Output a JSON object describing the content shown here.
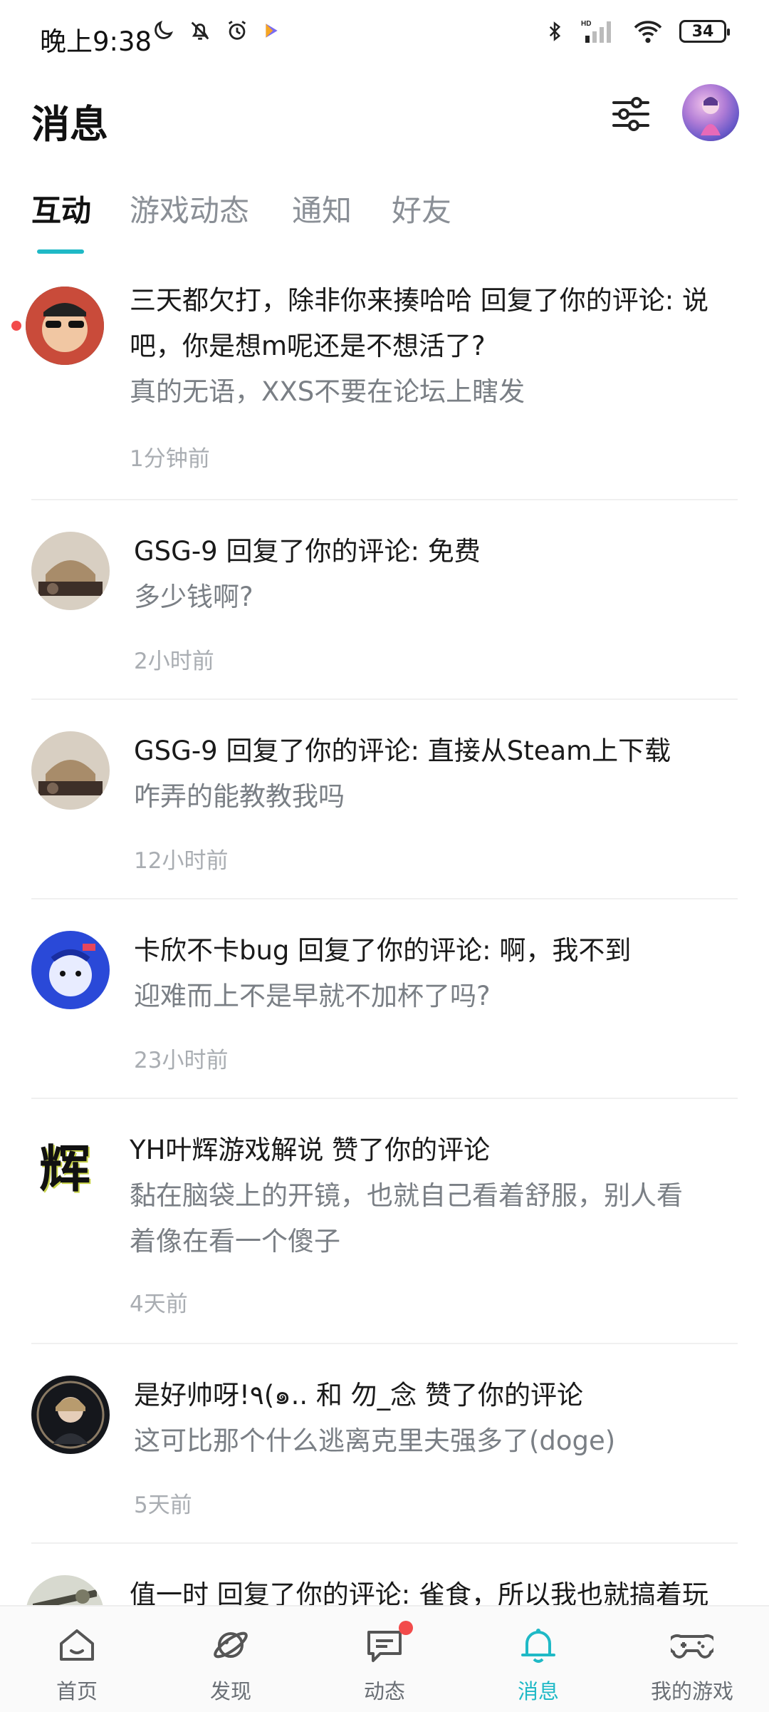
{
  "status_bar": {
    "time": "晚上9:38",
    "battery": "34",
    "network_label": "HD"
  },
  "header": {
    "title": "消息"
  },
  "tabs": [
    {
      "label": "互动",
      "active": true
    },
    {
      "label": "游戏动态",
      "active": false
    },
    {
      "label": "通知",
      "active": false
    },
    {
      "label": "好友",
      "active": false
    }
  ],
  "messages": [
    {
      "line1a": "三天都欠打，除非你来揍哈哈 回复了你的评论: 说",
      "line1b": "吧，你是想m呢还是不想活了?",
      "line2a": "真的无语，XXS不要在论坛上瞎发",
      "line2b": "",
      "time": "1分钟前",
      "unread": true,
      "avatar_icon": "user-avatar-sunglasses"
    },
    {
      "line1a": "GSG-9 回复了你的评论: 免费",
      "line1b": "",
      "line2a": "多少钱啊?",
      "line2b": "",
      "time": "2小时前",
      "unread": false,
      "avatar_icon": "user-avatar-gsg9"
    },
    {
      "line1a": "GSG-9 回复了你的评论: 直接从Steam上下载",
      "line1b": "",
      "line2a": "咋弄的能教教我吗",
      "line2b": "",
      "time": "12小时前",
      "unread": false,
      "avatar_icon": "user-avatar-gsg9"
    },
    {
      "line1a": "卡欣不卡bug 回复了你的评论: 啊，我不到",
      "line1b": "",
      "line2a": "迎难而上不是早就不加杯了吗?",
      "line2b": "",
      "time": "23小时前",
      "unread": false,
      "avatar_icon": "user-avatar-anime-blue"
    },
    {
      "line1a": "YH叶辉游戏解说 赞了你的评论",
      "line1b": "",
      "line2a": "黏在脑袋上的开镜，也就自己看着舒服，别人看",
      "line2b": "着像在看一个傻子",
      "time": "4天前",
      "unread": false,
      "avatar_icon": "user-avatar-calligraphy",
      "avatar_text": "辉"
    },
    {
      "line1a": "是好帅呀!٩(๑.. 和 勿_念 赞了你的评论",
      "line1b": "",
      "line2a": "这可比那个什么逃离克里夫强多了(doge)",
      "line2b": "",
      "time": "5天前",
      "unread": false,
      "avatar_icon": "user-avatar-portrait"
    },
    {
      "line1a": "值一时 回复了你的评论: 雀食，所以我也就搞着玩",
      "line1b": "",
      "line2a": "",
      "line2b": "",
      "time": "",
      "unread": false,
      "avatar_icon": "user-avatar-partial"
    }
  ],
  "bottom_nav": [
    {
      "label": "首页",
      "icon": "home-icon",
      "active": false
    },
    {
      "label": "发现",
      "icon": "discover-icon",
      "active": false
    },
    {
      "label": "动态",
      "icon": "feed-icon",
      "active": false,
      "badge": true
    },
    {
      "label": "消息",
      "icon": "bell-icon",
      "active": true
    },
    {
      "label": "我的游戏",
      "icon": "gamepad-icon",
      "active": false
    }
  ],
  "colors": {
    "accent": "#1fb9c6",
    "unread": "#f24b4b",
    "secondary_text": "#7a7f85",
    "time_text": "#a9adb2"
  }
}
